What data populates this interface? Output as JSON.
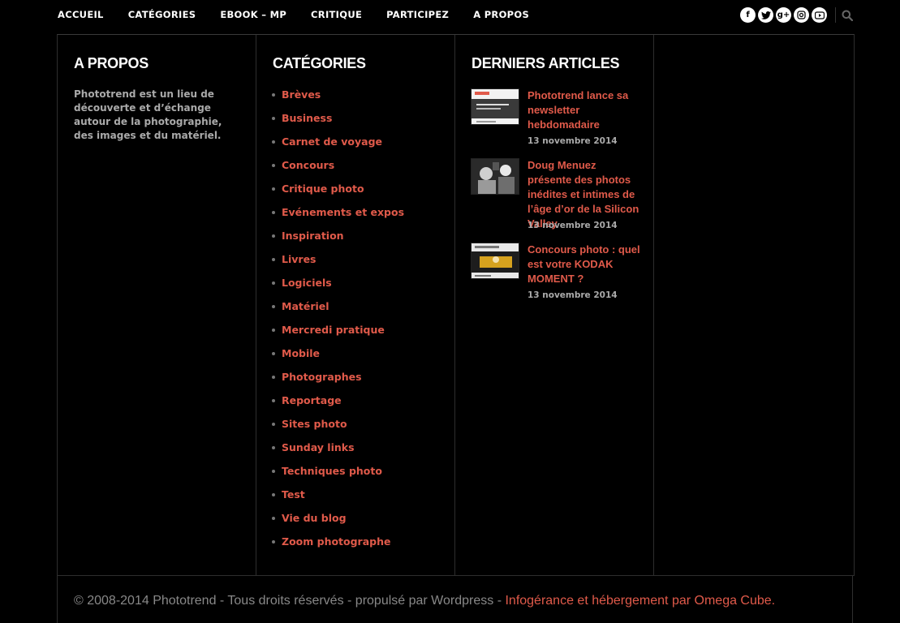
{
  "nav": {
    "items": [
      {
        "label": "ACCUEIL"
      },
      {
        "label": "CATÉGORIES"
      },
      {
        "label": "EBOOK – MP"
      },
      {
        "label": "CRITIQUE"
      },
      {
        "label": "PARTICIPEZ"
      },
      {
        "label": "A PROPOS"
      }
    ],
    "social_icons": [
      "facebook-icon",
      "twitter-icon",
      "google-plus-icon",
      "instagram-icon",
      "youtube-icon"
    ]
  },
  "about": {
    "title": "A PROPOS",
    "text": "Phototrend est un lieu de découverte et d’échange autour de la photographie, des images et du matériel."
  },
  "categories": {
    "title": "CATÉGORIES",
    "items": [
      "Brèves",
      "Business",
      "Carnet de voyage",
      "Concours",
      "Critique photo",
      "Evénements et expos",
      "Inspiration",
      "Livres",
      "Logiciels",
      "Matériel",
      "Mercredi pratique",
      "Mobile",
      "Photographes",
      "Reportage",
      "Sites photo",
      "Sunday links",
      "Techniques photo",
      "Test",
      "Vie du blog",
      "Zoom photographe"
    ]
  },
  "recent": {
    "title": "DERNIERS ARTICLES",
    "posts": [
      {
        "title": "Phototrend lance sa newsletter hebdomadaire",
        "date": "13 novembre 2014"
      },
      {
        "title": "Doug Menuez présente des photos inédites et intimes de l’âge d’or de la Silicon Valley",
        "date": "13 novembre 2014"
      },
      {
        "title": "Concours photo : quel est votre KODAK MOMENT ?",
        "date": "13 novembre 2014"
      }
    ]
  },
  "footer": {
    "copyright": "© 2008-2014 Phototrend - Tous droits réservés - propulsé par Wordpress - ",
    "link": "Infogérance et hébergement par Omega Cube."
  },
  "colors": {
    "accent": "#e05a4a",
    "background": "#000000"
  }
}
